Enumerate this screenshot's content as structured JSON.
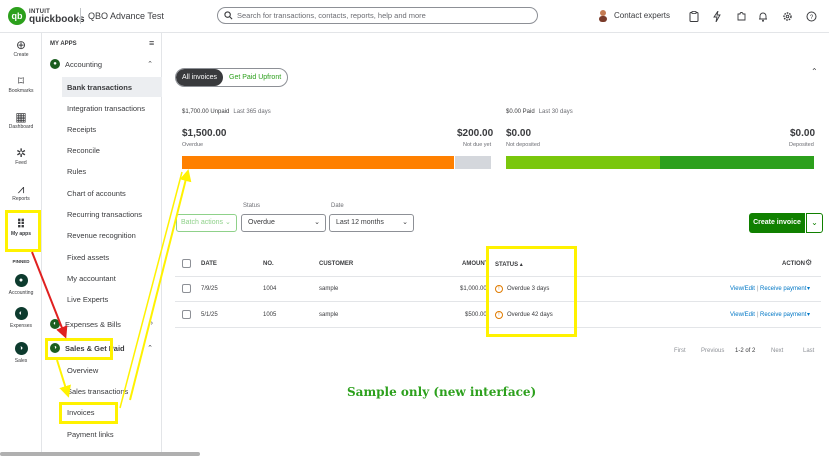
{
  "topbar": {
    "logo_top": "INTUIT",
    "logo_bottom": "quickbooks",
    "company": "QBO Advance Test",
    "search_placeholder": "Search for transactions, contacts, reports, help and more",
    "contact_label": "Contact experts"
  },
  "rail": {
    "create": "Create",
    "bookmarks": "Bookmarks",
    "dashboard": "Dashboard",
    "feed": "Feed",
    "reports": "Reports",
    "myapps": "My apps",
    "pinned": "PINNED",
    "accounting": "Accounting",
    "expenses": "Expenses",
    "sales": "Sales"
  },
  "nav": {
    "header": "MY APPS",
    "accounting": "Accounting",
    "items": [
      "Bank transactions",
      "Integration transactions",
      "Receipts",
      "Reconcile",
      "Rules",
      "Chart of accounts",
      "Recurring transactions",
      "Revenue recognition",
      "Fixed assets",
      "My accountant",
      "Live Experts"
    ],
    "expenses": "Expenses & Bills",
    "sales": "Sales & Get Paid",
    "sales_items": [
      "Overview",
      "Sales transactions",
      "Invoices",
      "Payment links"
    ]
  },
  "toggle": {
    "all_invoices": "All invoices",
    "get_paid": "Get Paid Upfront"
  },
  "summary": {
    "unpaid_label": "$1,700.00 Unpaid",
    "unpaid_range": "Last 365 days",
    "overdue_amt": "$1,500.00",
    "overdue_label": "Overdue",
    "notdue_amt": "$200.00",
    "notdue_label": "Not due yet",
    "paid_label": "$0.00 Paid",
    "paid_range": "Last 30 days",
    "notdeposited_amt": "$0.00",
    "notdeposited_label": "Not deposited",
    "deposited_amt": "$0.00",
    "deposited_label": "Deposited",
    "colors": {
      "overdue": "#ff8000",
      "notdue": "#d4d7dc",
      "notdeposited": "#7ac70c",
      "deposited": "#2ca01c"
    }
  },
  "filters": {
    "batch": "Batch actions",
    "status_label": "Status",
    "status_value": "Overdue",
    "date_label": "Date",
    "date_value": "Last 12 months"
  },
  "create_invoice": "Create invoice",
  "table": {
    "headers": {
      "date": "DATE",
      "no": "NO.",
      "customer": "CUSTOMER",
      "amount": "AMOUNT",
      "status": "STATUS",
      "action": "ACTION"
    },
    "rows": [
      {
        "date": "7/9/25",
        "no": "1004",
        "customer": "sample",
        "amount": "$1,000.00",
        "status": "Overdue 3 days",
        "view": "View/Edit",
        "receive": "Receive payment"
      },
      {
        "date": "5/1/25",
        "no": "1005",
        "customer": "sample",
        "amount": "$500.00",
        "status": "Overdue 42 days",
        "view": "View/Edit",
        "receive": "Receive payment"
      }
    ]
  },
  "pager": {
    "first": "First",
    "previous": "Previous",
    "range": "1-2 of 2",
    "next": "Next",
    "last": "Last"
  },
  "note": "Sample only (new interface)"
}
